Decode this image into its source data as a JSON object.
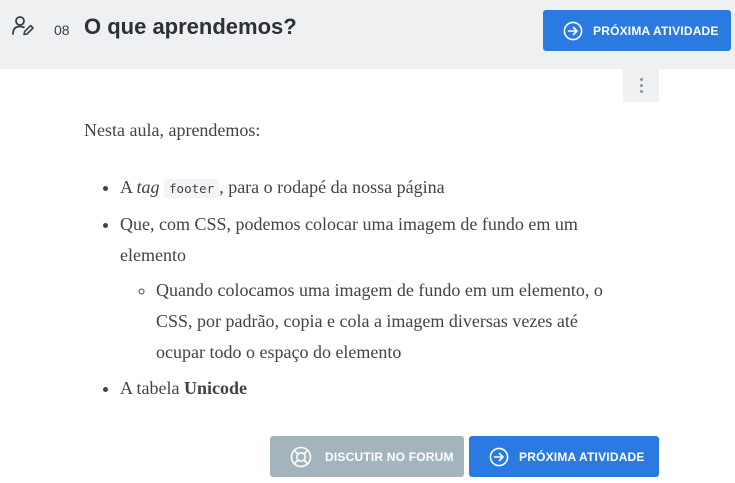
{
  "header": {
    "task_number": "08",
    "title": "O que aprendemos?",
    "next_button_label": "PRÓXIMA ATIVIDADE"
  },
  "content": {
    "intro": "Nesta aula, aprendemos:",
    "item1": {
      "prefix": "A ",
      "emphasis": "tag",
      "code": "footer",
      "suffix": ", para o rodapé da nossa página"
    },
    "item2": {
      "text": "Que, com CSS, podemos colocar uma imagem de fundo em um elemento",
      "subitem": "Quando colocamos uma imagem de fundo em um elemento, o CSS, por padrão, copia e cola a imagem diversas vezes até ocupar todo o espaço do elemento"
    },
    "item3": {
      "prefix": "A tabela ",
      "bold": "Unicode"
    }
  },
  "footer": {
    "forum_button_label": "DISCUTIR NO FORUM",
    "next_button_label": "PRÓXIMA ATIVIDADE"
  },
  "colors": {
    "primary": "#2a7ae2",
    "forum_button": "#a4b4bd",
    "header_bg": "#eef0f2"
  },
  "icons": [
    "task-person-edit-icon",
    "arrow-circle-right-icon",
    "lifebuoy-icon",
    "kebab-menu-icon"
  ]
}
